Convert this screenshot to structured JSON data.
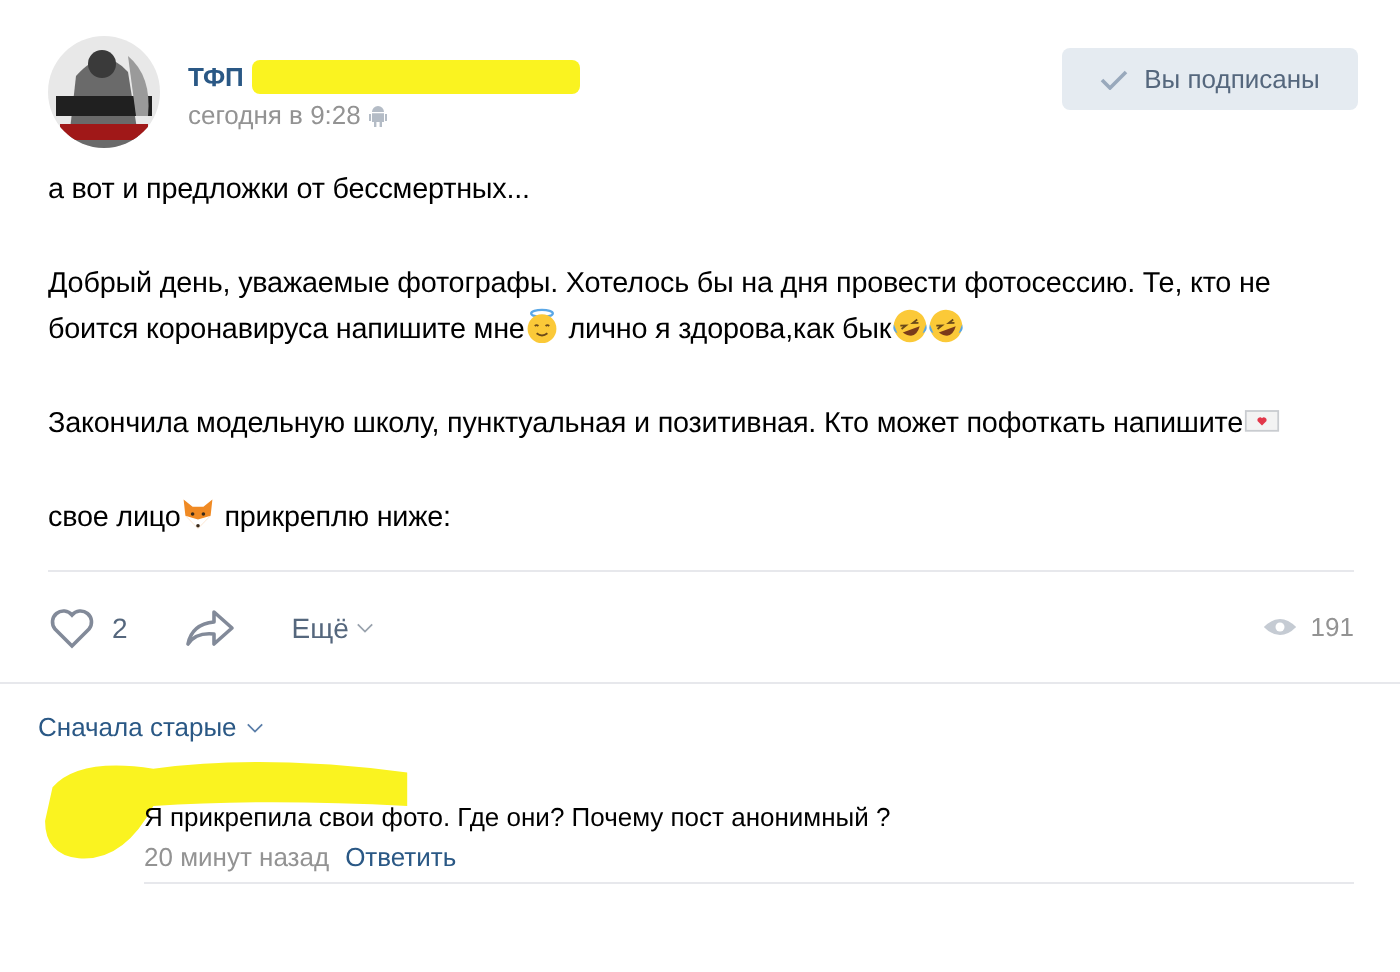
{
  "post": {
    "author": {
      "name": "ТФП",
      "name_redacted": true
    },
    "time": "сегодня в 9:28",
    "subscribe_button": {
      "label": "Вы подписаны",
      "subscribed": true
    },
    "paragraphs": [
      [
        {
          "kind": "text",
          "text": "а вот и предложки от бессмертных..."
        }
      ],
      [
        {
          "kind": "text",
          "text": "Добрый день, уважаемые фотографы. Хотелось бы на дня провести фотосессию. Те, кто не боится коронавируса напишите мне"
        },
        {
          "kind": "halo-face"
        },
        {
          "kind": "text",
          "text": " лично я здорова,как бык"
        },
        {
          "kind": "laughing-face"
        },
        {
          "kind": "laughing-face"
        }
      ],
      [
        {
          "kind": "text",
          "text": "Закончила модельную школу, пунктуальная и позитивная. Кто может пофоткать напишите"
        },
        {
          "kind": "love-letter"
        }
      ],
      [
        {
          "kind": "text",
          "text": "свое лицо"
        },
        {
          "kind": "fox-face"
        },
        {
          "kind": "text",
          "text": " прикреплю ниже:"
        }
      ]
    ],
    "likes": {
      "count": "2",
      "liked": false
    },
    "more": "Ещё",
    "views": "191"
  },
  "comments": {
    "sort": "Сначала старые",
    "items": [
      {
        "author_redacted": true,
        "text": "Я прикрепила свои фото. Где они? Почему пост анонимный ?",
        "time": "20 минут назад",
        "reply": "Ответить"
      }
    ]
  }
}
